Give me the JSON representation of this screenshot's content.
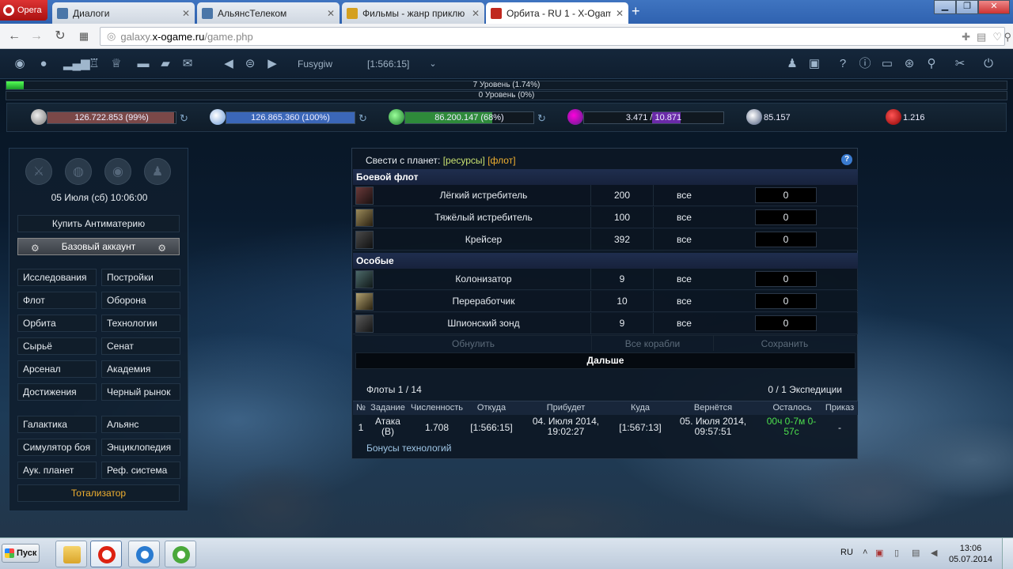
{
  "browser": {
    "opera_label": "Opera",
    "tabs": [
      {
        "label": "Диалоги",
        "icon_color": "#4a76a8"
      },
      {
        "label": "АльянсТелеком",
        "icon_color": "#4a76a8"
      },
      {
        "label": "Фильмы - жанр приклю",
        "icon_color": "#d4a020"
      },
      {
        "label": "Орбита - RU 1 - X-Ogame",
        "icon_color": "#c0281e"
      }
    ],
    "url_prefix": "galaxy.",
    "url_host": "x-ogame.ru",
    "url_path": "/game.php"
  },
  "game": {
    "player_name": "Fusygiw",
    "coords": "[1:566:15]",
    "level_bars": [
      {
        "label": "7 Уровень (1.74%)",
        "fill": 0.0174
      },
      {
        "label": "0 Уровень (0%)",
        "fill": 0
      }
    ],
    "resources": {
      "metal": {
        "text": "126.722.853 (99%)",
        "fill": 0.99,
        "color": "#7a4848"
      },
      "crystal": {
        "text": "126.865.360 (100%)",
        "fill": 1.0,
        "color": "#3b67b8"
      },
      "deuterium": {
        "text": "86.200.147 (68%)",
        "fill": 0.68,
        "color": "#2e8a3a"
      },
      "energy_used": "3.471",
      "energy_sep": " / ",
      "energy_total": "10.871",
      "darkmatter": "85.157",
      "antimatter": "1.216"
    }
  },
  "left": {
    "date": "05 Июля (сб) 10:06:00",
    "buy_antimatter": "Купить Антиматерию",
    "base_account": "Базовый аккаунт",
    "menu1": [
      [
        "Исследования",
        "Постройки"
      ],
      [
        "Флот",
        "Оборона"
      ],
      [
        "Орбита",
        "Технологии"
      ],
      [
        "Сырьё",
        "Сенат"
      ],
      [
        "Арсенал",
        "Академия"
      ],
      [
        "Достижения",
        "Черный рынок"
      ]
    ],
    "menu2": [
      [
        "Галактика",
        "Альянс"
      ],
      [
        "Симулятор боя",
        "Энциклопедия"
      ],
      [
        "Аук. планет",
        "Реф. система"
      ]
    ],
    "totalizator": "Тотализатор"
  },
  "main": {
    "gather_prefix": "Свести с планет: ",
    "gather_res": "[ресурсы]",
    "gather_fleet": "[флот]",
    "help": "?",
    "section_combat": "Боевой флот",
    "section_special": "Особые",
    "combat_ships": [
      {
        "name": "Лёгкий истребитель",
        "count": "200",
        "all": "все",
        "input": "0",
        "img": "#6a3a3a"
      },
      {
        "name": "Тяжёлый истребитель",
        "count": "100",
        "all": "все",
        "input": "0",
        "img": "#7a6a4a"
      },
      {
        "name": "Крейсер",
        "count": "392",
        "all": "все",
        "input": "0",
        "img": "#3a3a3a"
      }
    ],
    "special_ships": [
      {
        "name": "Колонизатор",
        "count": "9",
        "all": "все",
        "input": "0",
        "img": "#3c5a5a"
      },
      {
        "name": "Переработчик",
        "count": "10",
        "all": "все",
        "input": "0",
        "img": "#8a7a4a"
      },
      {
        "name": "Шпионский зонд",
        "count": "9",
        "all": "все",
        "input": "0",
        "img": "#4a4a4a"
      }
    ],
    "reset": "Обнулить",
    "all_ships": "Все корабли",
    "save": "Сохранить",
    "next": "Дальше",
    "fleets": "Флоты 1 / 14",
    "expeditions": "0 / 1 Экспедиции",
    "fleet_headers": [
      "№",
      "Задание",
      "Численность",
      "Откуда",
      "Прибудет",
      "Куда",
      "Вернётся",
      "Осталось",
      "Приказ"
    ],
    "fleet_row": {
      "num": "1",
      "mission": "Атака (В)",
      "count": "1.708",
      "from": "[1:566:15]",
      "arrive": "04. Июля 2014, 19:02:27",
      "to": "[1:567:13]",
      "return": "05. Июля 2014, 09:57:51",
      "left": "00ч 0-7м 0-57с",
      "order": "-"
    },
    "bonus": "Бонусы технологий"
  },
  "taskbar": {
    "start": "Пуск",
    "lang": "RU",
    "time": "13:06",
    "date": "05.07.2014"
  }
}
